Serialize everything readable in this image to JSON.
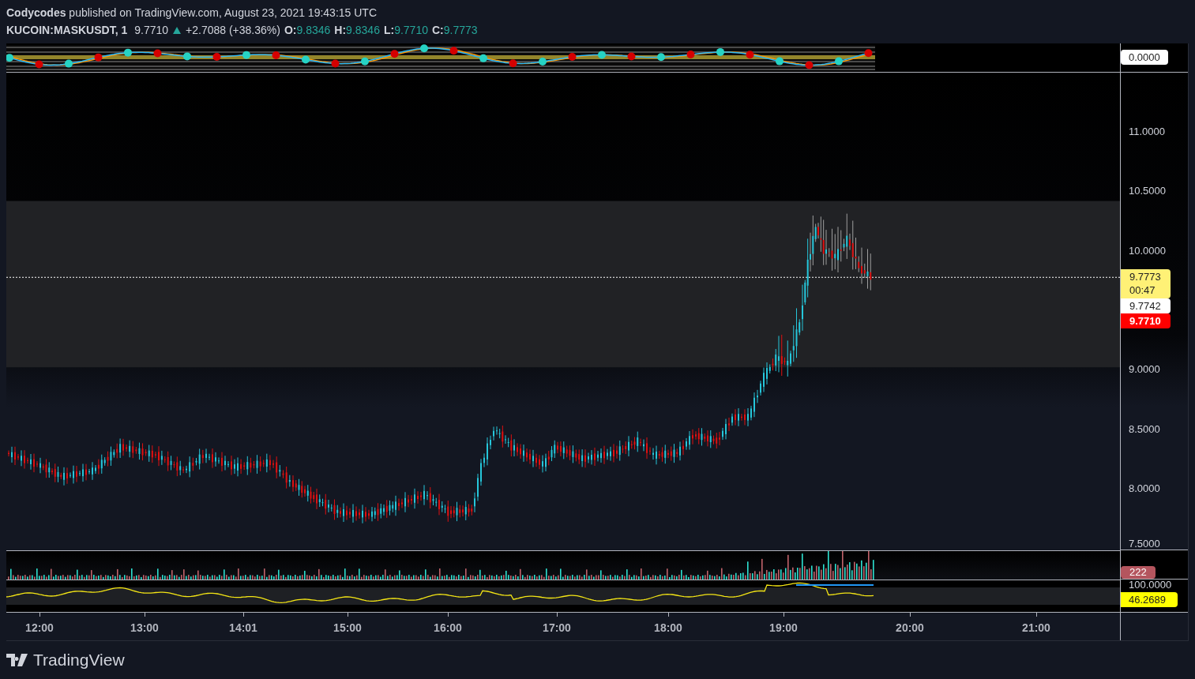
{
  "header": {
    "byline": "**Codycodes** published on TradingView.com, August 23, 2021 19:43:15 UTC",
    "symbol": "KUCOIN:MASKUSDT, 1",
    "last": "9.7710",
    "rising": true,
    "change": "+2.7088 (+38.36%)",
    "ohlc": [
      {
        "label": "O:",
        "value": "9.8346"
      },
      {
        "label": "H:",
        "value": "9.8346"
      },
      {
        "label": "L:",
        "value": "9.7710"
      },
      {
        "label": "C:",
        "value": "9.7773"
      }
    ]
  },
  "oscillator_pane": {
    "axis_label": "0.0000"
  },
  "price_chart": {
    "price_axis": [
      "11.0000",
      "10.5000",
      "10.0000",
      "9.0000",
      "8.5000",
      "8.0000",
      "7.5000"
    ],
    "time_axis": [
      "12:00",
      "13:00",
      "14:01",
      "15:00",
      "16:00",
      "17:00",
      "18:00",
      "19:00",
      "20:00",
      "21:00"
    ],
    "price_tags": [
      {
        "kind": "last",
        "value": "9.7773",
        "countdown": "00:47"
      },
      {
        "kind": "bid",
        "value": "9.7742"
      },
      {
        "kind": "low",
        "value": "9.7710"
      }
    ]
  },
  "volume_pane": {
    "tag": "222"
  },
  "rsi_pane": {
    "axis_label": "100.0000",
    "tag": "46.2689"
  },
  "footer": {
    "brand": "TradingView"
  }
}
